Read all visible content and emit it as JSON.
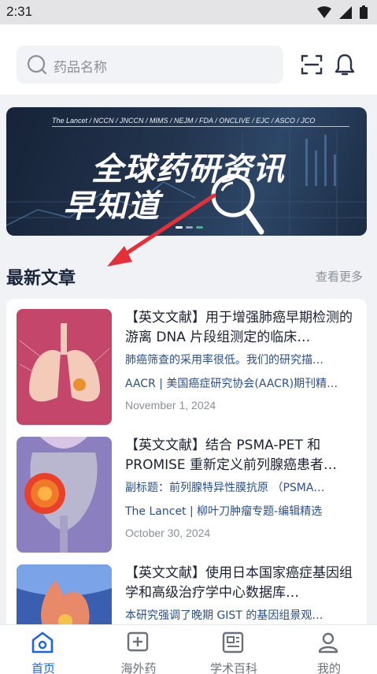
{
  "status_bar": {
    "time": "2:31"
  },
  "search": {
    "placeholder": "药品名称"
  },
  "banner": {
    "sources": "The Lancet / NCCN / JNCCN / MIMS / NEJM / FDA / ONCLIVE / EJC / ASCO / JCO",
    "line1": "全球药研资讯",
    "line2": "早知道"
  },
  "section": {
    "title": "最新文章",
    "more": "查看更多"
  },
  "articles": [
    {
      "title": "【英文文献】用于增强肺癌早期检测的游离 DNA 片段组测定的临床…",
      "desc": "肺癌筛查的采用率很低。我们的研究描…",
      "source": "AACR | 美国癌症研究协会(AACR)期刊精…",
      "date": "November 1, 2024"
    },
    {
      "title": "【英文文献】结合 PSMA-PET 和 PROMISE 重新定义前列腺癌患者…",
      "desc": "副标题：前列腺特异性膜抗原 （PSMA…",
      "source": "The Lancet | 柳叶刀肿瘤专题-编辑精选",
      "date": "October 30, 2024"
    },
    {
      "title": "【英文文献】使用日本国家癌症基因组学和高级治疗学中心数据库…",
      "desc": "本研究强调了晚期 GIST 的基因组景观…",
      "source": "",
      "date": ""
    }
  ],
  "tabs": [
    {
      "label": "首页",
      "icon": "home-icon",
      "active": true
    },
    {
      "label": "海外药",
      "icon": "plus-square-icon",
      "active": false
    },
    {
      "label": "学术百科",
      "icon": "newspaper-icon",
      "active": false
    },
    {
      "label": "我的",
      "icon": "user-icon",
      "active": false
    }
  ],
  "colors": {
    "accent": "#1c63e8",
    "link_text": "#2a4f8c",
    "annotation_arrow": "#e5303a"
  }
}
